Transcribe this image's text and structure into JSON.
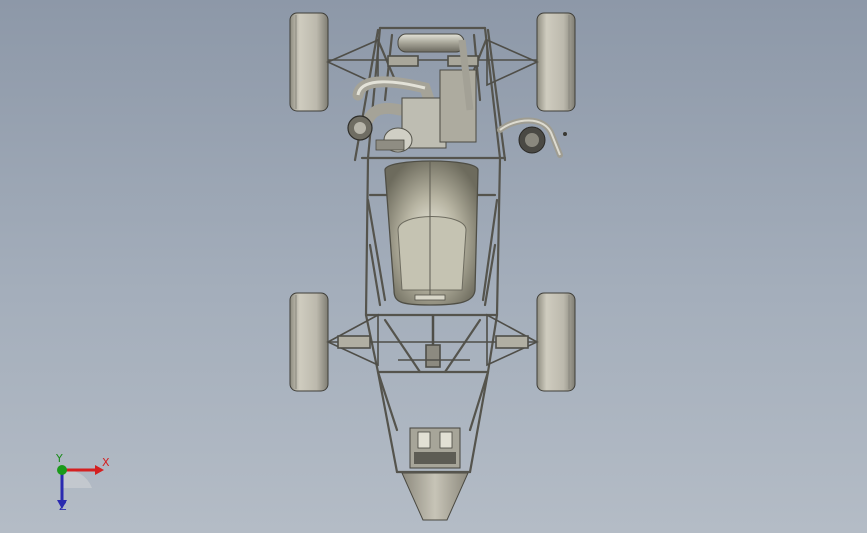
{
  "viewport": {
    "background_top": "#8d98a8",
    "background_bottom": "#b4bcc6"
  },
  "model": {
    "subject": "formula-student-chassis-top-view",
    "colors": {
      "tire": "#b8b5a9",
      "frame": "#5a5a55",
      "seat": "#9b9986",
      "nose": "#a9a597",
      "engine": "#bdbcb2"
    }
  },
  "triad": {
    "x_label": "X",
    "y_label": "Y",
    "z_label": "Z",
    "x_color": "#d42020",
    "y_color": "#1a9a1a",
    "z_color": "#2a2ab0"
  }
}
